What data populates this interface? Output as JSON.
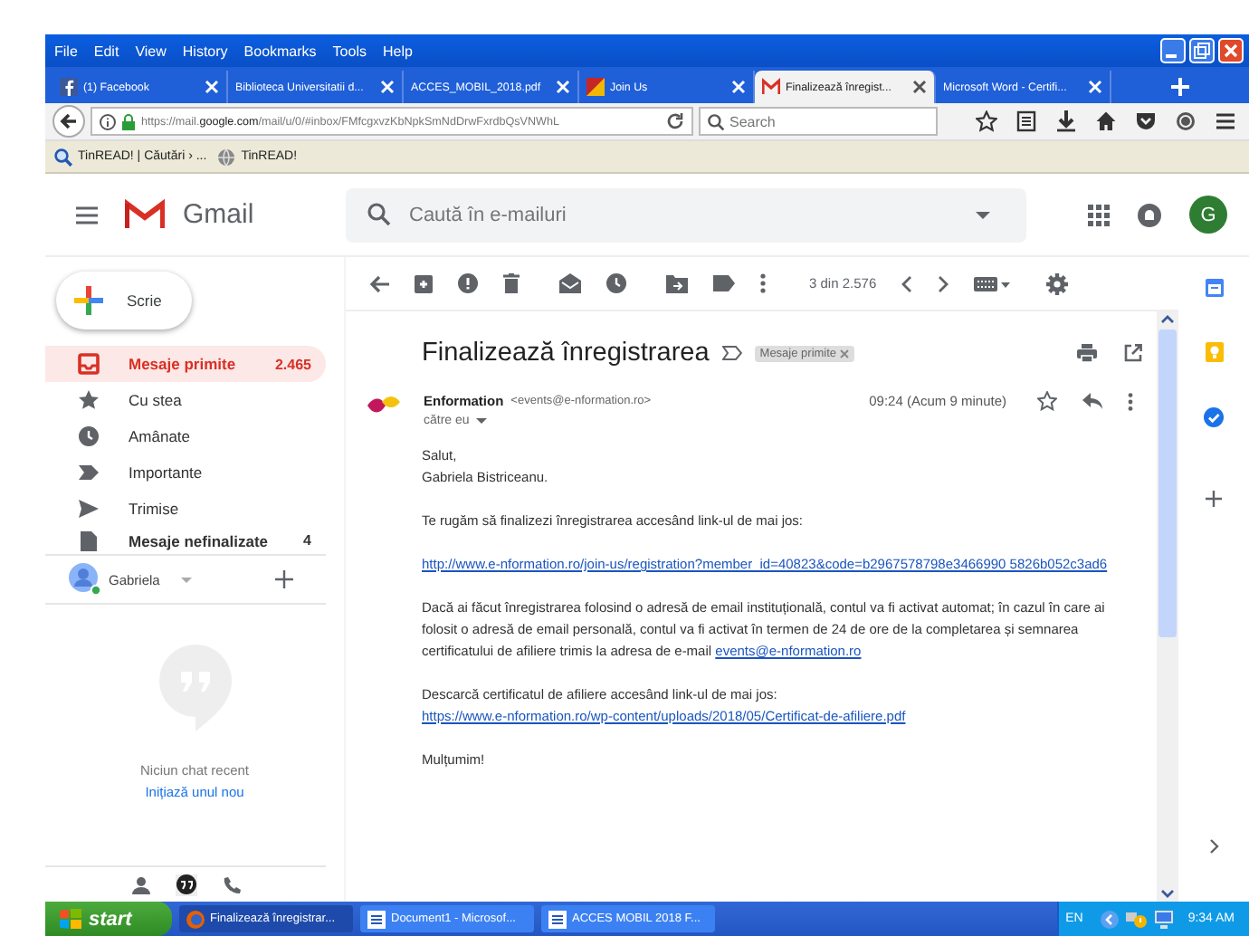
{
  "browser": {
    "menu": [
      "File",
      "Edit",
      "View",
      "History",
      "Bookmarks",
      "Tools",
      "Help"
    ],
    "tabs": [
      {
        "label": "(1) Facebook",
        "selected": false
      },
      {
        "label": "Biblioteca Universitatii d...",
        "selected": false
      },
      {
        "label": "ACCES_MOBIL_2018.pdf",
        "selected": false
      },
      {
        "label": "Join Us",
        "selected": false
      },
      {
        "label": "Finalizează înregist...",
        "selected": true
      },
      {
        "label": "Microsoft Word - Certifi...",
        "selected": false
      }
    ],
    "url": "https://mail.**google.com**/mail/u/0/#inbox/FMfcgxvzKbNpkSmNdDrwFxrdbQsVNWhL",
    "search": {
      "placeholder": "Search"
    },
    "bookmarks": [
      "TinREAD! | Căutări › ...",
      "TinREAD!"
    ]
  },
  "gmail": {
    "brand": "Gmail",
    "search": {
      "placeholder": "Caută în e-mailuri"
    },
    "avatar": "G",
    "compose": "Scrie",
    "folders": [
      {
        "label": "Mesaje primite",
        "count": "2.465",
        "selected": true
      },
      {
        "label": "Cu stea",
        "selected": false
      },
      {
        "label": "Amânate",
        "selected": false
      },
      {
        "label": "Importante",
        "selected": false
      },
      {
        "label": "Trimise",
        "selected": false
      },
      {
        "label": "Mesaje nefinalizate",
        "count": "4",
        "selected": false
      }
    ],
    "chat": {
      "user": "Gabriela",
      "empty": "Niciun chat recent",
      "start": "Inițiază unul nou"
    },
    "counter": "3 din 2.576",
    "message": {
      "subject": "Finalizează înregistrarea",
      "label": "Mesaje primite",
      "sender": "Enformation",
      "email": "<events@e-nformation.ro>",
      "time": "09:24 (Acum 9 minute)",
      "to": "către eu",
      "paragraphs": [
        {
          "lines": [
            {
              "text": "Salut,"
            },
            {
              "text": "Gabriela Bistriceanu."
            }
          ]
        },
        {
          "lines": [
            {
              "text": "Te rugăm să finalizezi înregistrarea accesând link-ul de mai jos:"
            }
          ]
        },
        {
          "lines": [
            {
              "link": "http://www.e-nformation.ro/join-us/registration?member_id=40823&code=b2967578798e3466990 5826b052c3ad6"
            }
          ]
        },
        {
          "lines": [
            {
              "text": "Dacă ai făcut înregistrarea folosind o adresă de email instituțională, contul va fi activat automat; în cazul în care ai folosit o adresă de email personală, contul va fi activat în termen de 24 de ore de la completarea și semnarea certificatului de afiliere trimis la adresa de e-mail",
              "link": "events@e-nformation.ro"
            }
          ]
        },
        {
          "lines": [
            {
              "text": "Descarcă certificatul de afiliere accesând link-ul de mai jos:"
            },
            {
              "link": "https://www.e-nformation.ro/wp-content/uploads/2018/05/Certificat-de-afiliere.pdf"
            }
          ]
        },
        {
          "lines": [
            {
              "text": "Mulțumim!"
            }
          ]
        }
      ]
    }
  },
  "taskbar": {
    "start": "start",
    "tasks": [
      "Finalizează înregistrar...",
      "Document1 - Microsof...",
      "ACCES MOBIL 2018 F..."
    ],
    "language": "EN",
    "clock": "9:34 AM"
  }
}
